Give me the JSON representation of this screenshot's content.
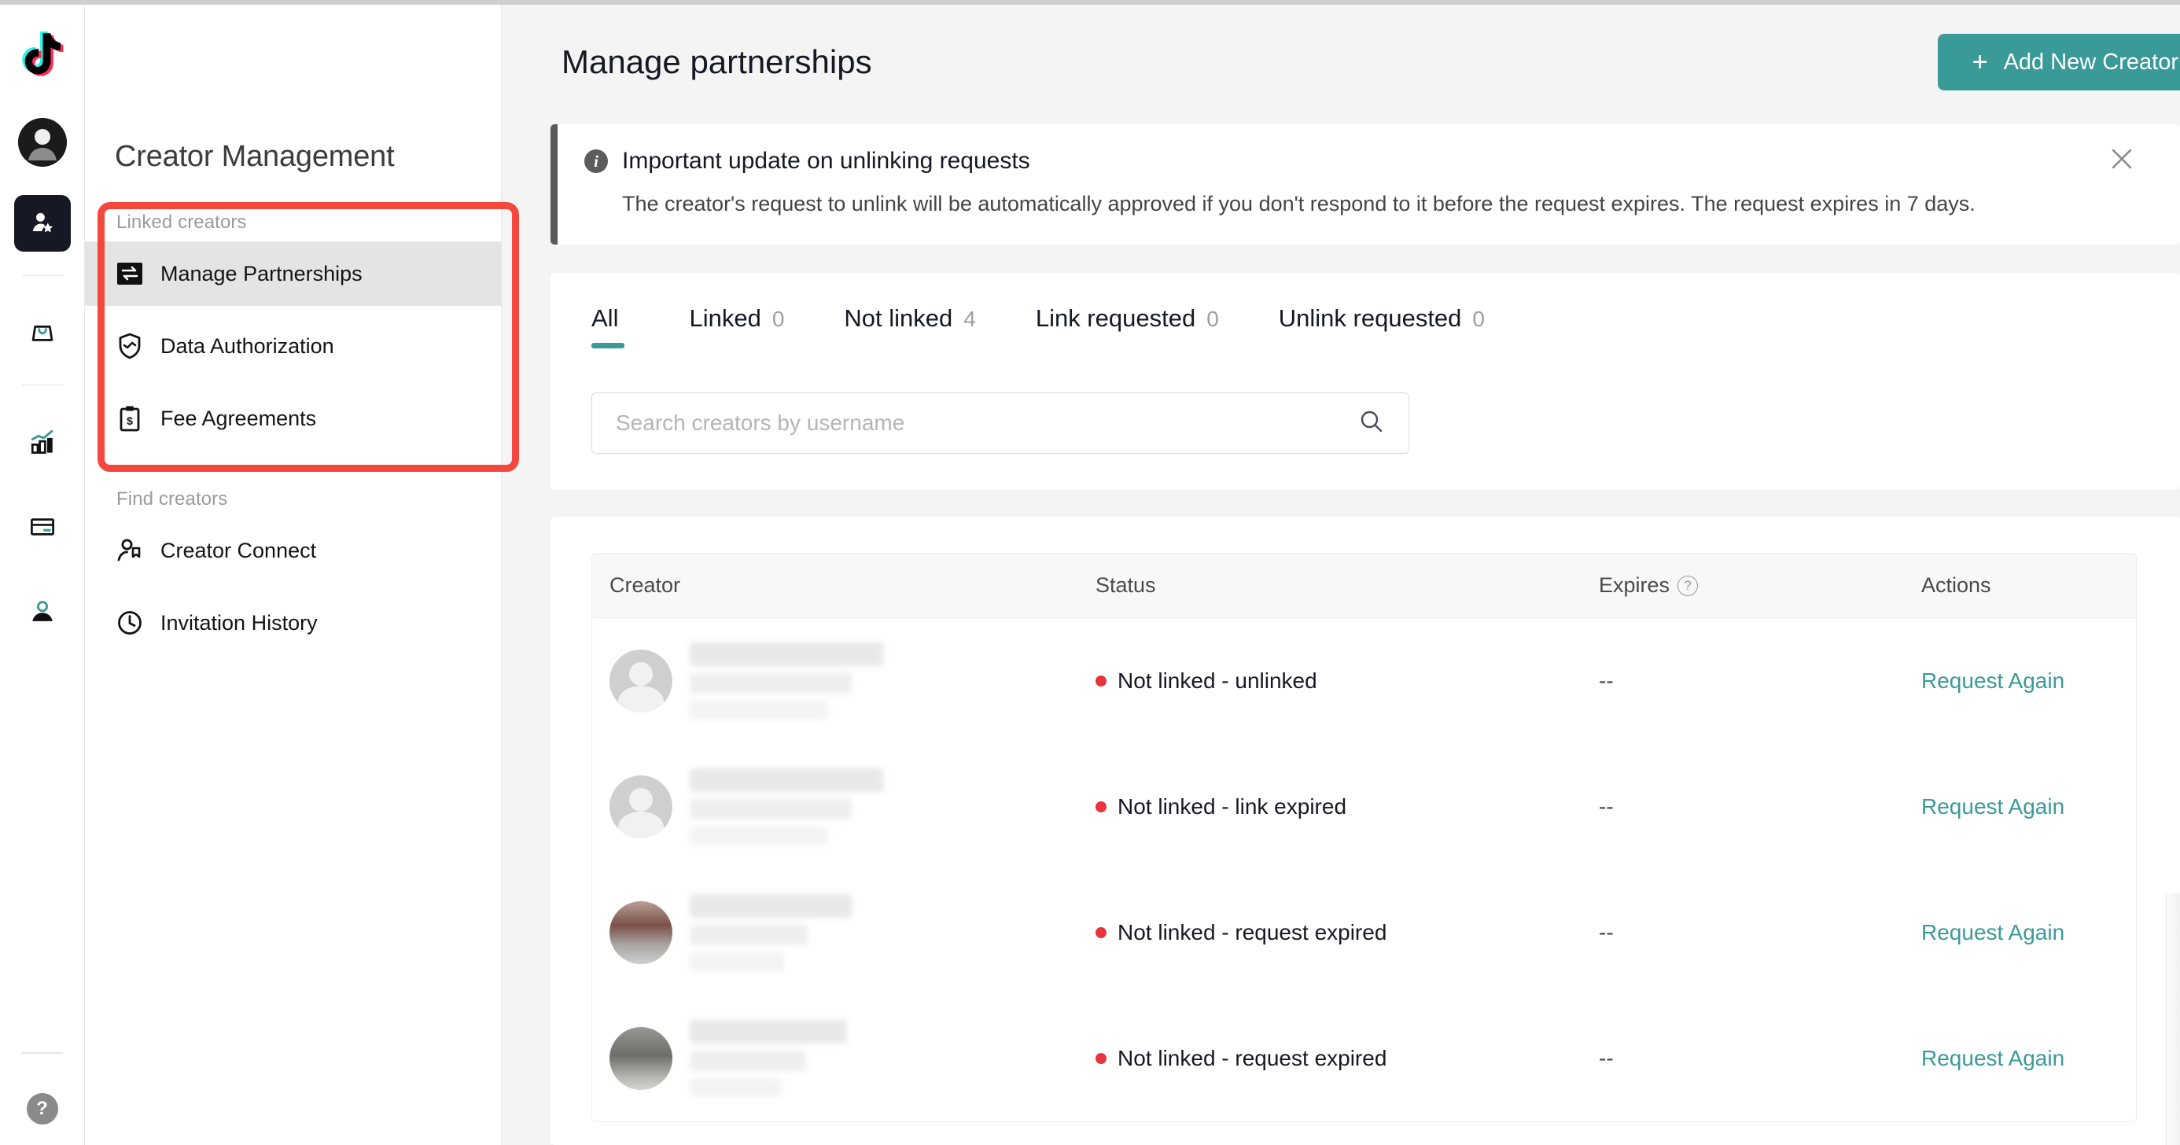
{
  "rail": {
    "logo_icon": "tiktok-logo-icon",
    "avatar_icon": "user-avatar-icon",
    "items": [
      {
        "icon": "creator-star-icon",
        "name": "creator-management",
        "active": true
      },
      {
        "icon": "shopping-bag-icon",
        "name": "orders",
        "active": false
      },
      {
        "icon": "analytics-bar-chart-icon",
        "name": "analytics",
        "active": false
      },
      {
        "icon": "credit-card-icon",
        "name": "finance",
        "active": false
      },
      {
        "icon": "person-icon",
        "name": "account",
        "active": false
      }
    ],
    "help_label": "?"
  },
  "sidebar": {
    "title": "Creator Management",
    "groups": [
      {
        "label": "Linked creators",
        "items": [
          {
            "label": "Manage Partnerships",
            "icon": "exchange-arrows-icon",
            "selected": true
          },
          {
            "label": "Data Authorization",
            "icon": "shield-check-icon",
            "selected": false
          },
          {
            "label": "Fee Agreements",
            "icon": "clipboard-dollar-icon",
            "selected": false
          }
        ]
      },
      {
        "label": "Find creators",
        "items": [
          {
            "label": "Creator Connect",
            "icon": "person-bookmark-icon",
            "selected": false
          },
          {
            "label": "Invitation History",
            "icon": "clock-icon",
            "selected": false
          }
        ]
      }
    ]
  },
  "header": {
    "title": "Manage partnerships",
    "add_button_label": "Add New Creator",
    "add_button_plus": "+"
  },
  "banner": {
    "title": "Important update on unlinking requests",
    "body": "The creator's request to unlink will be automatically approved if you don't respond to it before the request expires. The request expires in 7 days.",
    "info_icon": "info-icon",
    "close_icon": "close-icon"
  },
  "tabs": [
    {
      "label": "All",
      "count": "",
      "active": true
    },
    {
      "label": "Linked",
      "count": "0",
      "active": false
    },
    {
      "label": "Not linked",
      "count": "4",
      "active": false
    },
    {
      "label": "Link requested",
      "count": "0",
      "active": false
    },
    {
      "label": "Unlink requested",
      "count": "0",
      "active": false
    }
  ],
  "search": {
    "placeholder": "Search creators by username",
    "value": "",
    "icon": "search-icon"
  },
  "table": {
    "columns": [
      "Creator",
      "Status",
      "Expires",
      "Actions"
    ],
    "expires_help_icon": "question-mark-icon",
    "rows": [
      {
        "creator": "",
        "avatar": "placeholder",
        "status": "Not linked - unlinked",
        "expires": "--",
        "action": "Request Again"
      },
      {
        "creator": "",
        "avatar": "placeholder",
        "status": "Not linked - link expired",
        "expires": "--",
        "action": "Request Again"
      },
      {
        "creator": "",
        "avatar": "photo-1",
        "status": "Not linked - request expired",
        "expires": "--",
        "action": "Request Again"
      },
      {
        "creator": "",
        "avatar": "photo-2",
        "status": "Not linked - request expired",
        "expires": "--",
        "action": "Request Again"
      }
    ]
  },
  "colors": {
    "accent_teal": "#3a9a98",
    "annotation_red": "#f4483f",
    "status_red": "#e8343a",
    "sidebar_selected": "#e4e4e4",
    "page_bg": "#f4f4f4"
  }
}
